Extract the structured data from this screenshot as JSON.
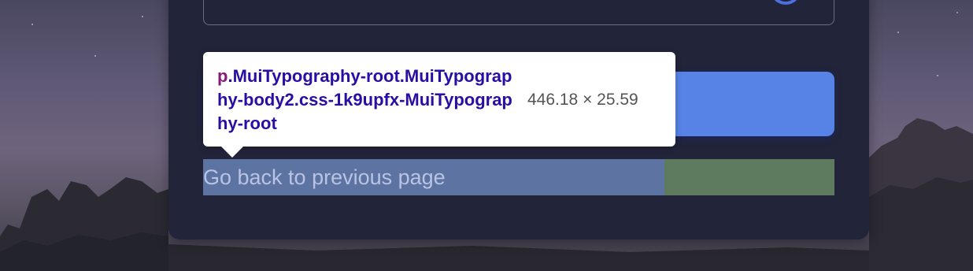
{
  "inspector_tooltip": {
    "tag_name": "p",
    "selector": ".MuiTypography-root.MuiTypography-body2.css-1k9upfx-MuiTypography-root",
    "dimensions": "446.18 × 25.59"
  },
  "form": {
    "back_link_label": "Go back to previous page"
  },
  "colors": {
    "card_background": "#222439",
    "button_blue": "#5782e6",
    "highlight_content": "#5d73a2",
    "highlight_margin": "#5e7b5f",
    "selector_text": "#2a0ea3",
    "tag_text": "#8a1877"
  }
}
